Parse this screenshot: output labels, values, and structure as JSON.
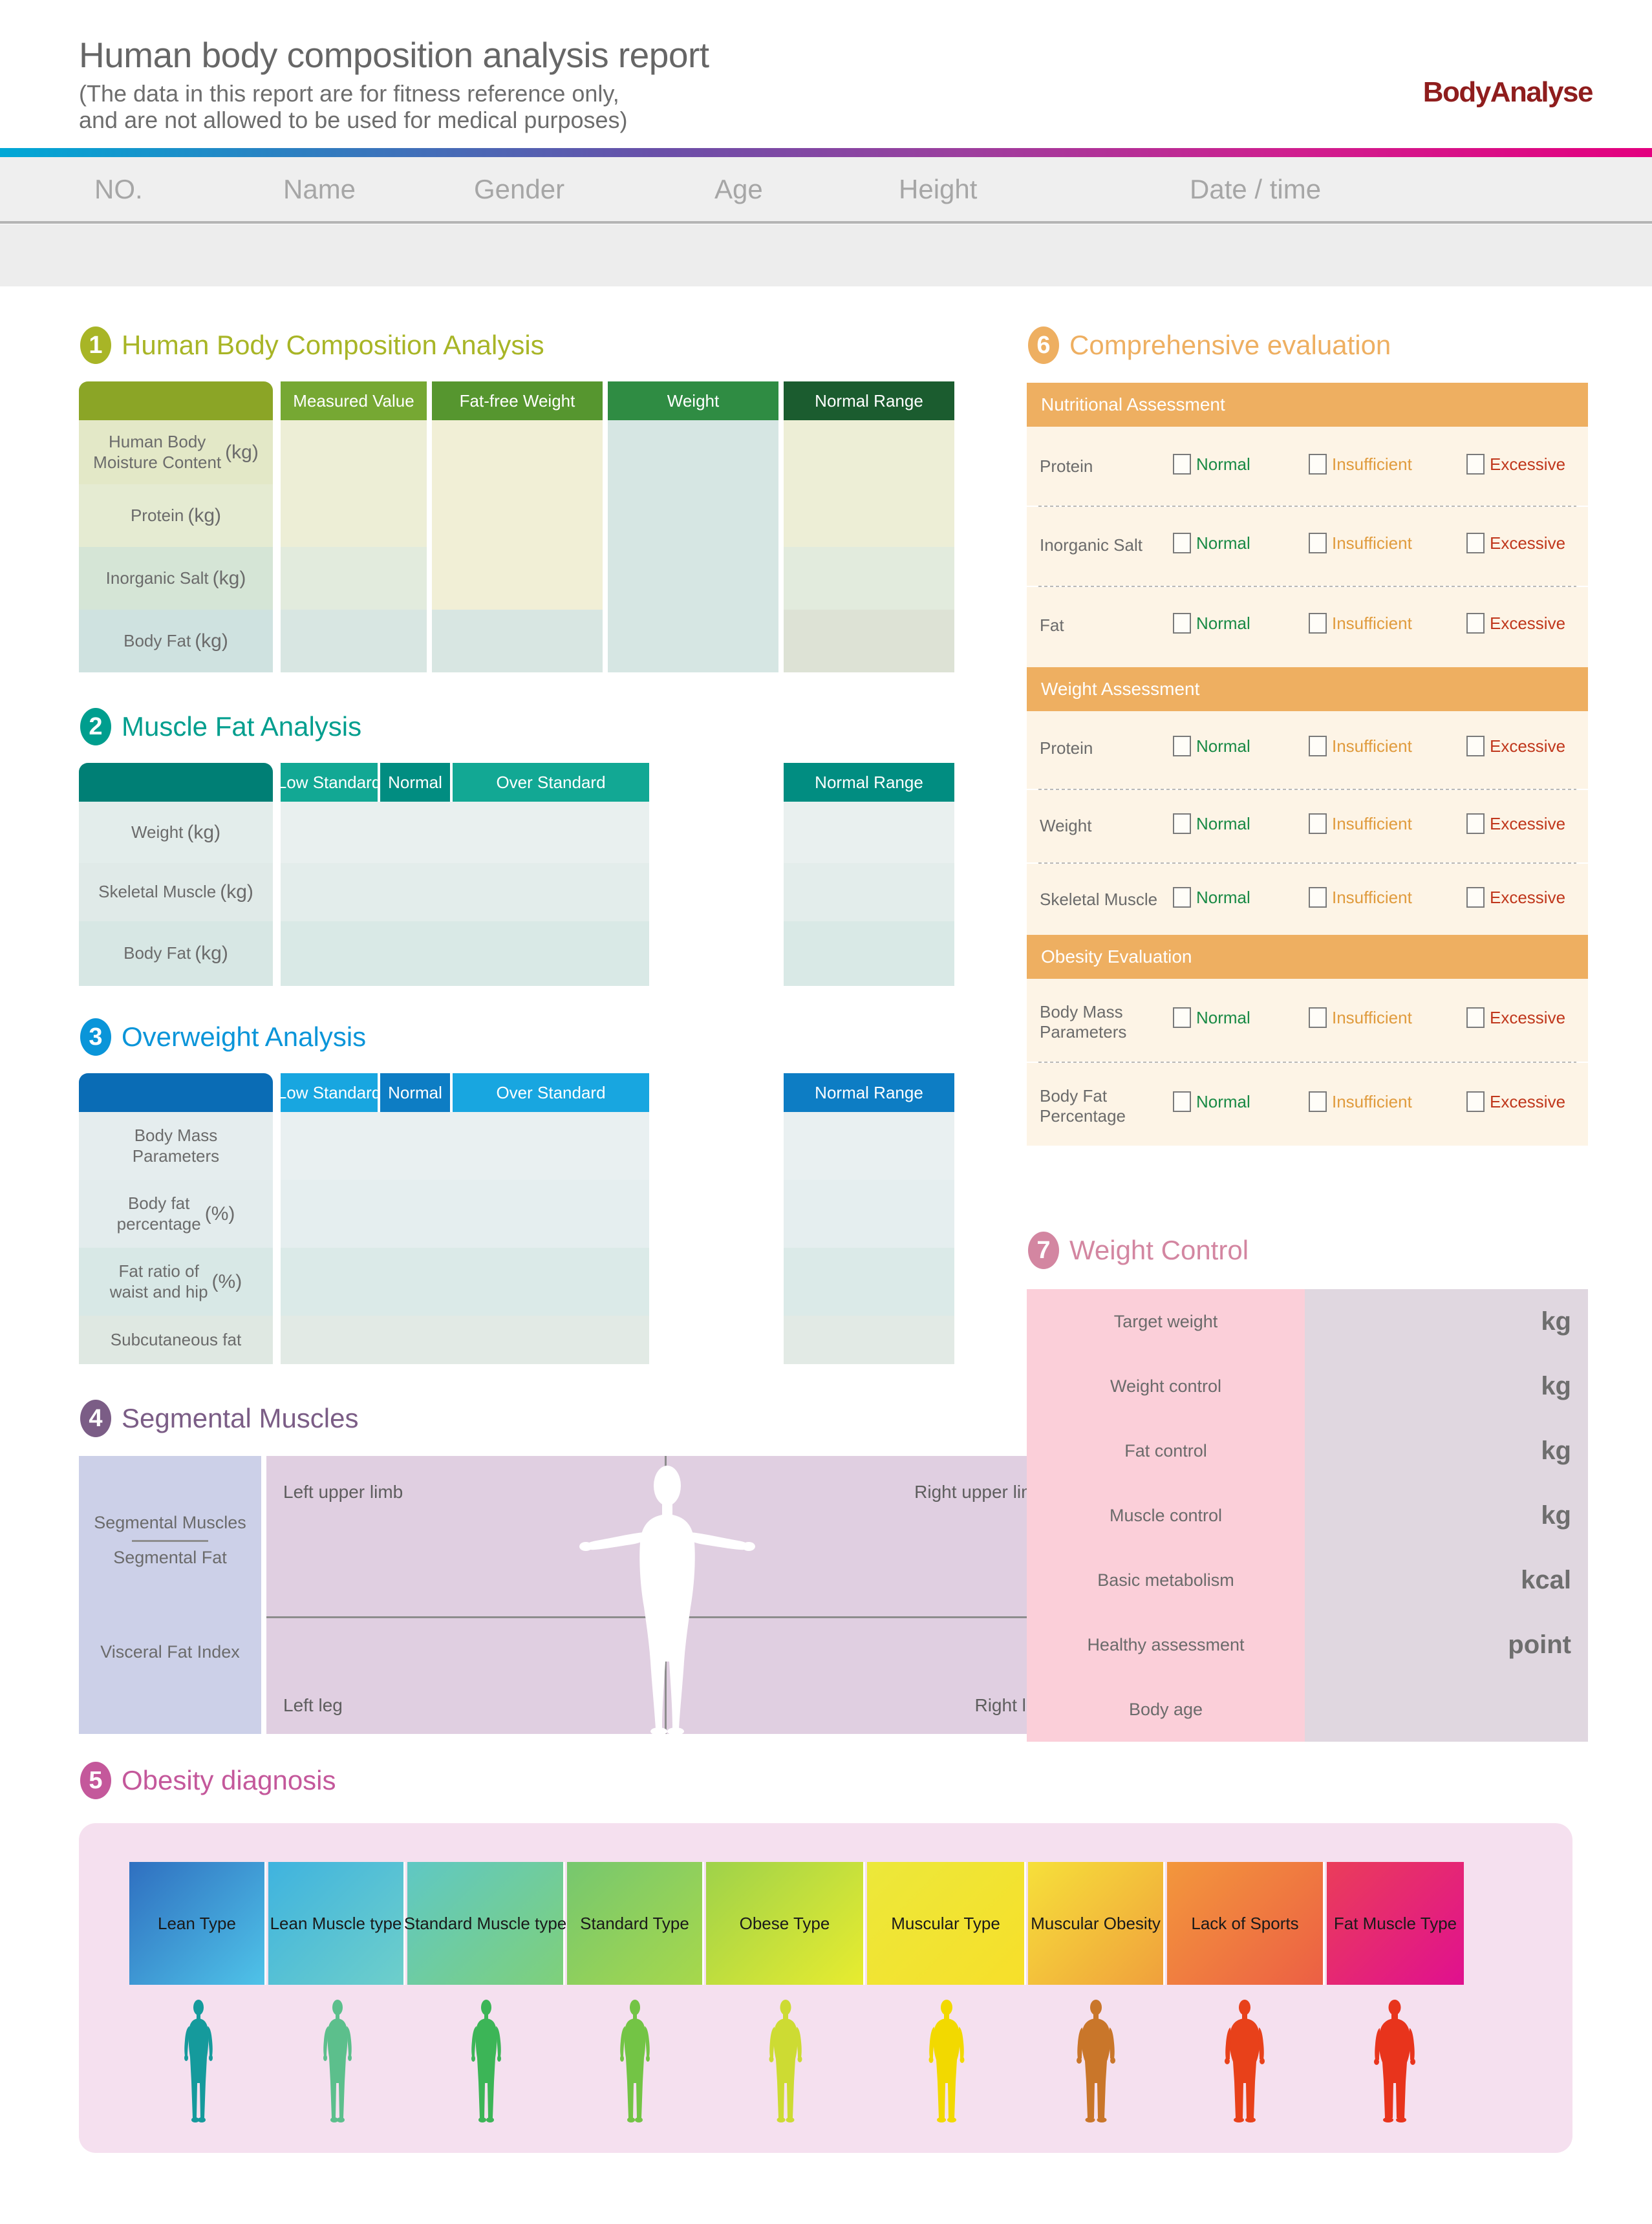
{
  "header": {
    "title": "Human body composition analysis report",
    "subtitle_line1": "(The data in this report are for fitness reference only,",
    "subtitle_line2": "and are not allowed to be used for medical purposes)",
    "brand": "BodyAnalyse",
    "fields": [
      "NO.",
      "Name",
      "Gender",
      "Age",
      "Height",
      "Date / time"
    ]
  },
  "colors": {
    "section1": "#a8b526",
    "section2": "#009e8e",
    "section3": "#0a95d9",
    "section4": "#7b5d86",
    "section5": "#c4589b",
    "section6": "#eeaf61",
    "section7": "#d386a1",
    "normal": "#198a45",
    "insufficient": "#e09b3d",
    "excessive": "#c0371c",
    "brand": "#8f1d1d"
  },
  "section1": {
    "number": "1",
    "title": "Human Body Composition Analysis",
    "columns": [
      "Measured Value",
      "Fat-free Weight",
      "Weight",
      "Normal Range"
    ],
    "rows": [
      {
        "label": "Human Body\nMoisture Content",
        "unit": "(kg)"
      },
      {
        "label": "Protein",
        "unit": "(kg)"
      },
      {
        "label": "Inorganic Salt",
        "unit": "(kg)"
      },
      {
        "label": "Body Fat",
        "unit": "(kg)"
      }
    ]
  },
  "section2": {
    "number": "2",
    "title": "Muscle Fat Analysis",
    "columns": [
      "Low Standard",
      "Normal",
      "Over Standard",
      "Normal Range"
    ],
    "rows": [
      {
        "label": "Weight",
        "unit": "(kg)"
      },
      {
        "label": "Skeletal Muscle",
        "unit": "(kg)"
      },
      {
        "label": "Body Fat",
        "unit": "(kg)"
      }
    ]
  },
  "section3": {
    "number": "3",
    "title": "Overweight Analysis",
    "columns": [
      "Low Standard",
      "Normal",
      "Over Standard",
      "Normal Range"
    ],
    "rows": [
      {
        "label": "Body Mass\nParameters",
        "unit": ""
      },
      {
        "label": "Body fat\npercentage",
        "unit": "(%)"
      },
      {
        "label": "Fat ratio of\nwaist and hip",
        "unit": "(%)"
      },
      {
        "label": "Subcutaneous fat",
        "unit": ""
      }
    ]
  },
  "section4": {
    "number": "4",
    "title": "Segmental Muscles",
    "sidebar": {
      "item1": "Segmental Muscles",
      "item2": "Segmental Fat",
      "item3": "Visceral Fat Index"
    },
    "quadrants": {
      "top_left": "Left upper limb",
      "top_right": "Right upper limb",
      "bottom_left": "Left leg",
      "bottom_right": "Right leg"
    }
  },
  "section5": {
    "number": "5",
    "title": "Obesity diagnosis",
    "types": [
      {
        "label": "Lean Type",
        "c1": "#2f6fc0",
        "c2": "#4fc3e8",
        "fig": "#159a9c"
      },
      {
        "label": "Lean Muscle type",
        "c1": "#3fb3df",
        "c2": "#6ecfca",
        "fig": "#5cbf8c"
      },
      {
        "label": "Standard Muscle type",
        "c1": "#5fc8c4",
        "c2": "#7fd07a",
        "fig": "#3cb557"
      },
      {
        "label": "Standard Type",
        "c1": "#76c76f",
        "c2": "#a7d84b",
        "fig": "#73c445"
      },
      {
        "label": "Obese Type",
        "c1": "#9ed24a",
        "c2": "#e8ec2f",
        "fig": "#cddb33"
      },
      {
        "label": "Muscular Type",
        "c1": "#ece83a",
        "c2": "#f7df2a",
        "fig": "#f2d900"
      },
      {
        "label": "Muscular Obesity",
        "c1": "#f6e03a",
        "c2": "#f0a03c",
        "fig": "#c9762a"
      },
      {
        "label": "Lack of Sports",
        "c1": "#f3973c",
        "c2": "#ec5f44",
        "fig": "#e8411a"
      },
      {
        "label": "Fat Muscle Type",
        "c1": "#ea3d5a",
        "c2": "#e0108f",
        "fig": "#e8341c"
      }
    ]
  },
  "section6": {
    "number": "6",
    "title": "Comprehensive evaluation",
    "options": [
      "Normal",
      "Insufficient",
      "Excessive"
    ],
    "groups": [
      {
        "band": "Nutritional Assessment",
        "rows": [
          "Protein",
          "Inorganic Salt",
          "Fat"
        ]
      },
      {
        "band": "Weight Assessment",
        "rows": [
          "Protein",
          "Weight",
          "Skeletal Muscle"
        ]
      },
      {
        "band": "Obesity Evaluation",
        "rows": [
          "Body Mass\nParameters",
          "Body Fat\nPercentage"
        ]
      }
    ]
  },
  "section7": {
    "number": "7",
    "title": "Weight Control",
    "rows": [
      {
        "label": "Target weight",
        "unit": "kg"
      },
      {
        "label": "Weight control",
        "unit": "kg"
      },
      {
        "label": "Fat control",
        "unit": "kg"
      },
      {
        "label": "Muscle control",
        "unit": "kg"
      },
      {
        "label": "Basic metabolism",
        "unit": "kcal"
      },
      {
        "label": "Healthy assessment",
        "unit": "point"
      },
      {
        "label": "Body age",
        "unit": ""
      }
    ]
  }
}
